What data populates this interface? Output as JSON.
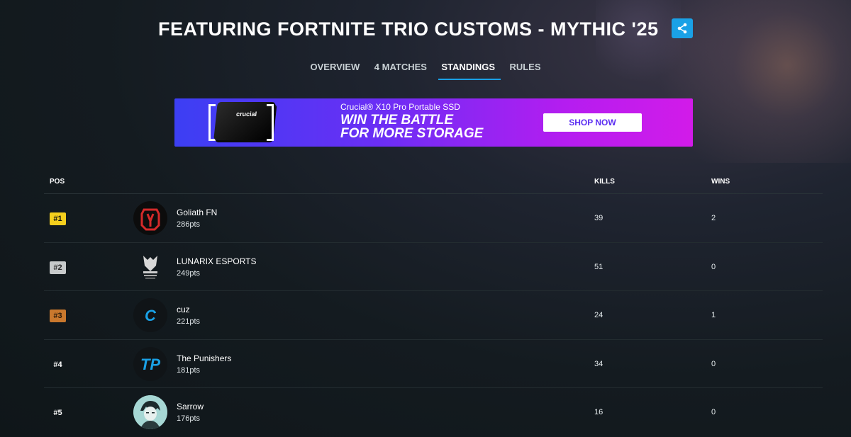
{
  "header": {
    "title": "FEATURING FORTNITE TRIO CUSTOMS - MYTHIC '25"
  },
  "tabs": [
    {
      "label": "OVERVIEW",
      "active": false
    },
    {
      "label": "4 MATCHES",
      "active": false
    },
    {
      "label": "STANDINGS",
      "active": true
    },
    {
      "label": "RULES",
      "active": false
    }
  ],
  "ad": {
    "product": "Crucial® X10 Pro Portable SSD",
    "headline_line1": "WIN THE BATTLE",
    "headline_line2": "FOR MORE STORAGE",
    "cta": "SHOP NOW",
    "device_logo": "crucial"
  },
  "table": {
    "headers": {
      "pos": "POS",
      "kills": "KILLS",
      "wins": "WINS"
    },
    "rows": [
      {
        "pos": "#1",
        "medal": "gold",
        "name": "Goliath FN",
        "pts": "286pts",
        "kills": "39",
        "wins": "2",
        "avatar_icon": "goliath-logo-icon"
      },
      {
        "pos": "#2",
        "medal": "silver",
        "name": "LUNARIX ESPORTS",
        "pts": "249pts",
        "kills": "51",
        "wins": "0",
        "avatar_icon": "lunarix-logo-icon"
      },
      {
        "pos": "#3",
        "medal": "bronze",
        "name": "cuz",
        "pts": "221pts",
        "kills": "24",
        "wins": "1",
        "avatar_icon": "cuz-logo-icon",
        "avatar_text": "C"
      },
      {
        "pos": "#4",
        "medal": "none",
        "name": "The Punishers",
        "pts": "181pts",
        "kills": "34",
        "wins": "0",
        "avatar_icon": "punishers-logo-icon",
        "avatar_text": "TP"
      },
      {
        "pos": "#5",
        "medal": "none",
        "name": "Sarrow",
        "pts": "176pts",
        "kills": "16",
        "wins": "0",
        "avatar_icon": "sarrow-avatar-icon"
      }
    ]
  },
  "colors": {
    "accent": "#1aa1e6",
    "gold": "#f5cf1d",
    "silver": "#c7cacb",
    "bronze": "#c9782d",
    "goliath_red": "#d42a2a"
  }
}
